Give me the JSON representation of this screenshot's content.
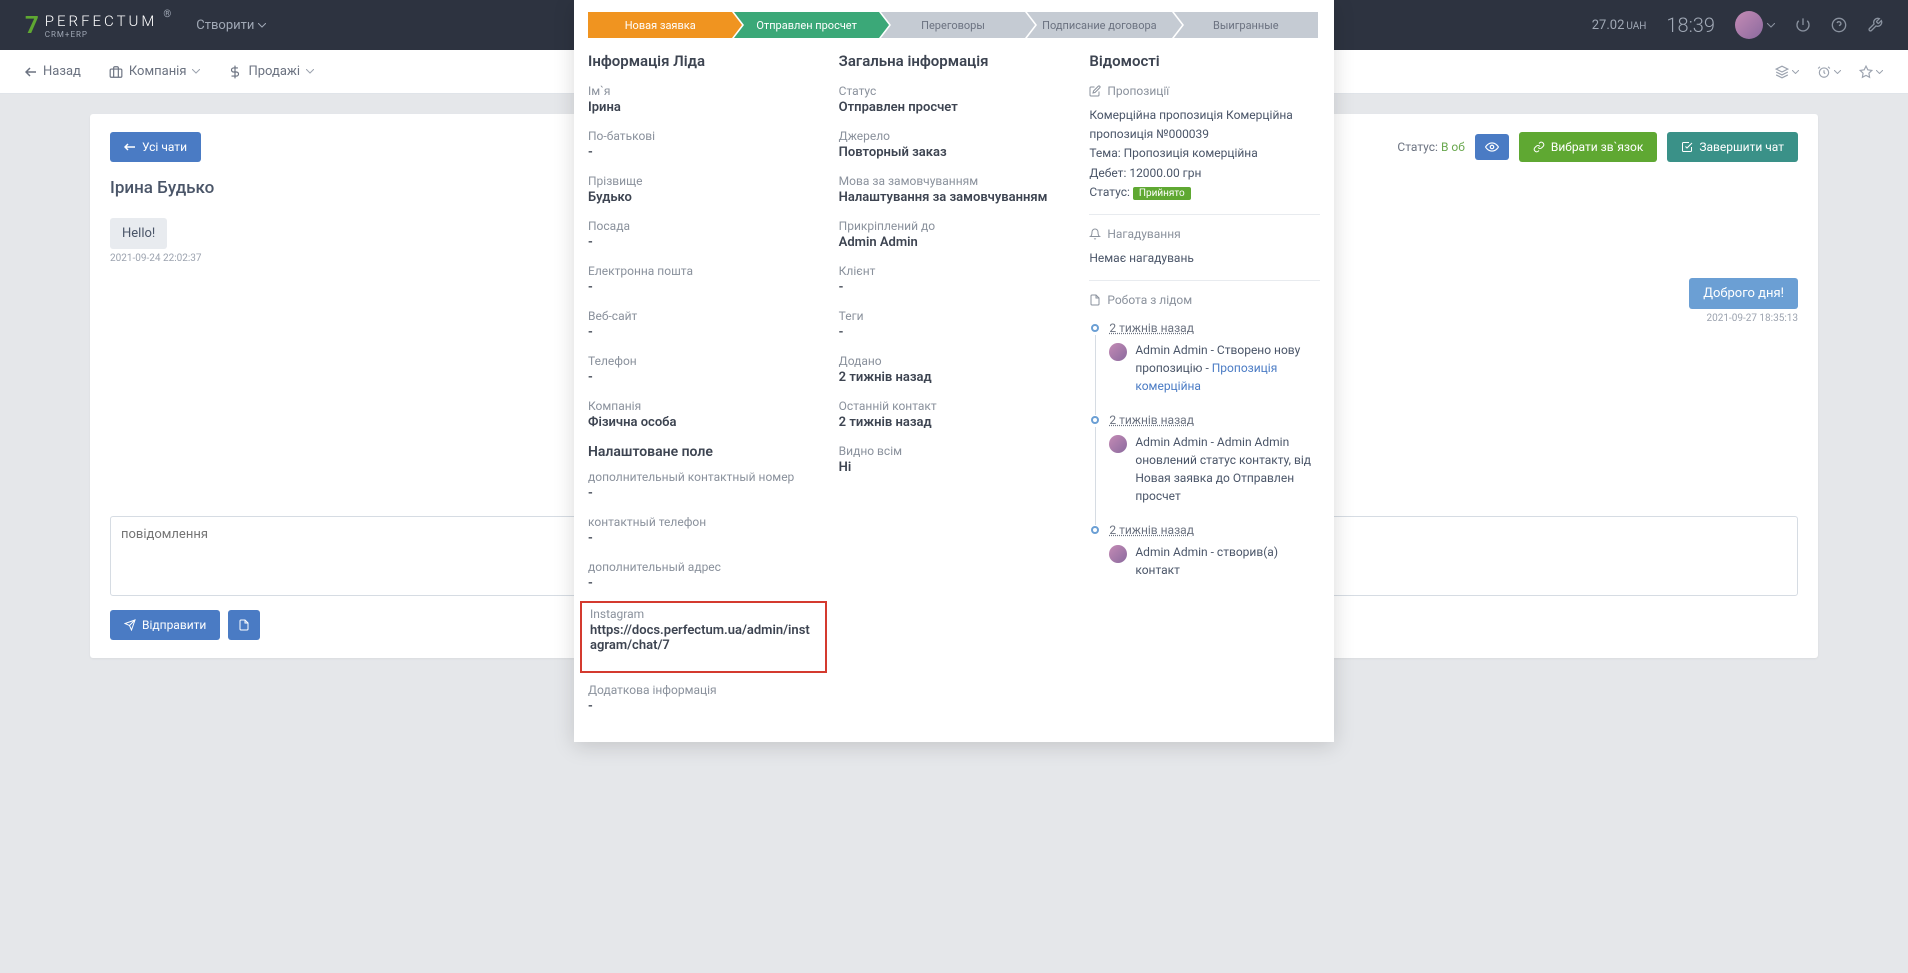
{
  "topbar": {
    "create": "Створити",
    "balance": "27.02",
    "currency": "UAH",
    "clock": "18:39"
  },
  "subbar": {
    "back": "Назад",
    "company": "Компанія",
    "sales": "Продажі"
  },
  "chat": {
    "all_chats": "Усі чати",
    "status_label": "Статус:",
    "status_value": "В об",
    "pick": "Вибрати зв`язок",
    "end": "Завершити чат",
    "lead_name": "Ірина Будько",
    "msg_in": "Hello!",
    "msg_in_time": "2021-09-24 22:02:37",
    "msg_out": "Доброго дня!",
    "msg_out_time": "2021-09-27 18:35:13",
    "placeholder": "повідомлення",
    "send": "Відправити"
  },
  "pipeline": [
    "Новая заявка",
    "Отправлен просчет",
    "Переговоры",
    "Подписание договора",
    "Выигранные"
  ],
  "col1": {
    "title": "Інформація Ліда",
    "fields": [
      {
        "l": "Ім`я",
        "v": "Ірина"
      },
      {
        "l": "По-батькові",
        "v": "-"
      },
      {
        "l": "Прізвище",
        "v": "Будько"
      },
      {
        "l": "Посада",
        "v": "-"
      },
      {
        "l": "Електронна пошта",
        "v": "-"
      },
      {
        "l": "Веб-сайт",
        "v": "-"
      },
      {
        "l": "Телефон",
        "v": "-"
      },
      {
        "l": "Компанія",
        "v": "Фізична особа"
      }
    ],
    "custom_title": "Налаштоване поле",
    "custom": [
      {
        "l": "дополнительный контактный номер",
        "v": "-"
      },
      {
        "l": "контактный телефон",
        "v": "-"
      },
      {
        "l": "дополнительный адрес",
        "v": "-"
      }
    ],
    "instagram_l": "Instagram",
    "instagram_v": "https://docs.perfectum.ua/admin/instagram/chat/7",
    "extra_l": "Додаткова інформація",
    "extra_v": "-"
  },
  "col2": {
    "title": "Загальна інформація",
    "fields": [
      {
        "l": "Статус",
        "v": "Отправлен просчет"
      },
      {
        "l": "Джерело",
        "v": "Повторный заказ"
      },
      {
        "l": "Мова за замовчуванням",
        "v": "Налаштування за замовчуванням"
      },
      {
        "l": "Прикріплений до",
        "v": "Admin Admin"
      },
      {
        "l": "Клієнт",
        "v": "-"
      },
      {
        "l": "Теги",
        "v": "-"
      },
      {
        "l": "Додано",
        "v": "2 тижнів назад"
      },
      {
        "l": "Останній контакт",
        "v": "2 тижнів назад"
      },
      {
        "l": "Видно всім",
        "v": "Ні"
      }
    ]
  },
  "col3": {
    "title": "Відомості",
    "prop_label": "Пропозиції",
    "prop_text": "Комерційна пропозиція Комерційна пропозиція №000039",
    "prop_theme": "Тема: Пропозиція комерційна",
    "prop_debit": "Дебет: 12000.00 грн",
    "prop_status_l": "Статус:",
    "prop_status_v": "Прийнято",
    "remind_label": "Нагадування",
    "remind_text": "Немає нагадувань",
    "work_label": "Робота з лідом",
    "timeline": [
      {
        "t": "2 тижнів назад",
        "txt": "Admin Admin - Створено нову пропозицію - ",
        "link": "Пропозиція комерційна"
      },
      {
        "t": "2 тижнів назад",
        "txt": "Admin Admin - Admin Admin оновлений статус контакту, від Новая заявка до Отправлен просчет"
      },
      {
        "t": "2 тижнів назад",
        "txt": "Admin Admin - створив(а) контакт"
      }
    ]
  }
}
